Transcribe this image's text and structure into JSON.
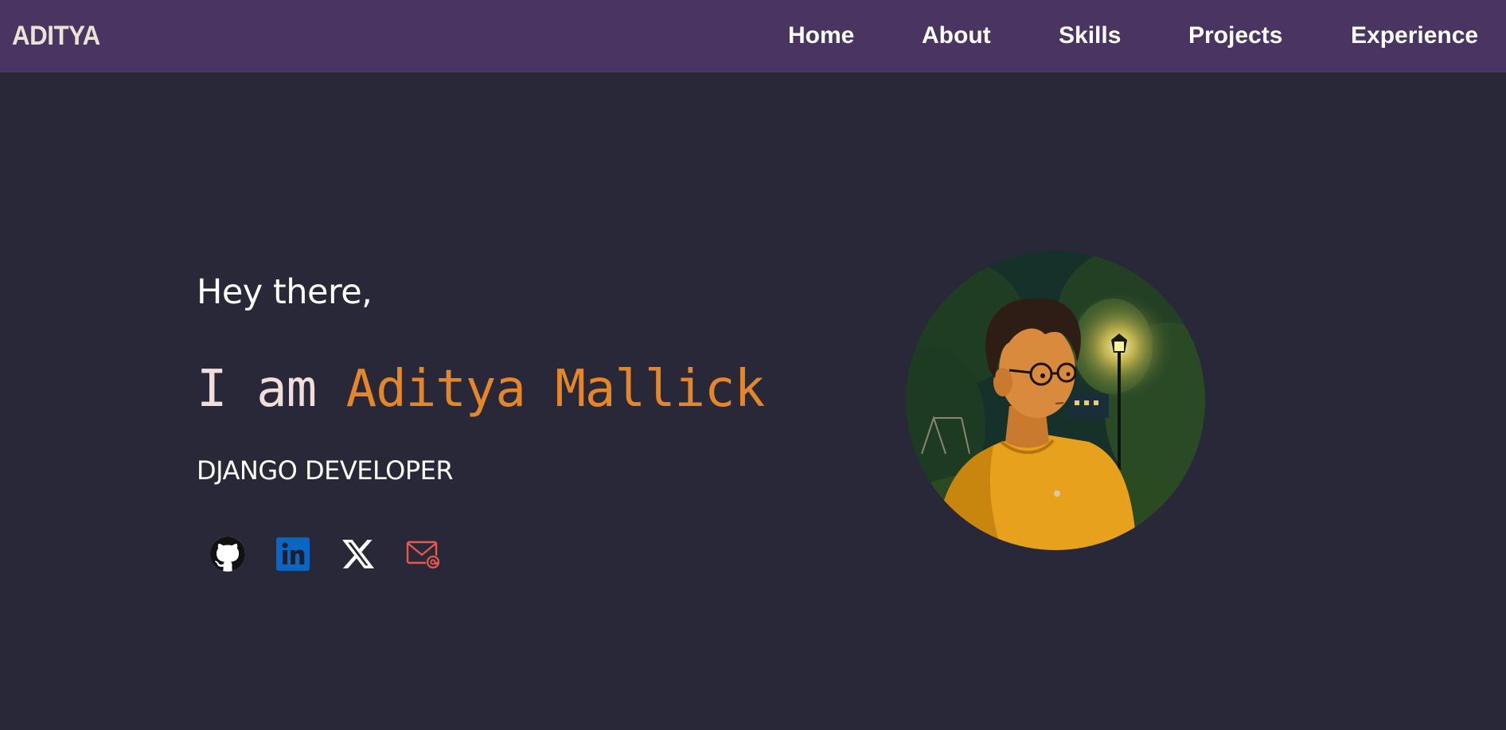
{
  "navbar": {
    "brand": "ADITYA",
    "links": [
      "Home",
      "About",
      "Skills",
      "Projects",
      "Experience"
    ]
  },
  "hero": {
    "greeting": "Hey there,",
    "name_prefix": "I am ",
    "name": "Aditya Mallick",
    "role": "DJANGO DEVELOPER"
  },
  "socials": [
    {
      "icon": "github-icon"
    },
    {
      "icon": "linkedin-icon"
    },
    {
      "icon": "x-twitter-icon"
    },
    {
      "icon": "email-icon"
    }
  ],
  "colors": {
    "navbar_bg": "#4a3462",
    "page_bg": "#282839",
    "accent": "#e6862a",
    "brand_text": "#e9e4d4"
  }
}
